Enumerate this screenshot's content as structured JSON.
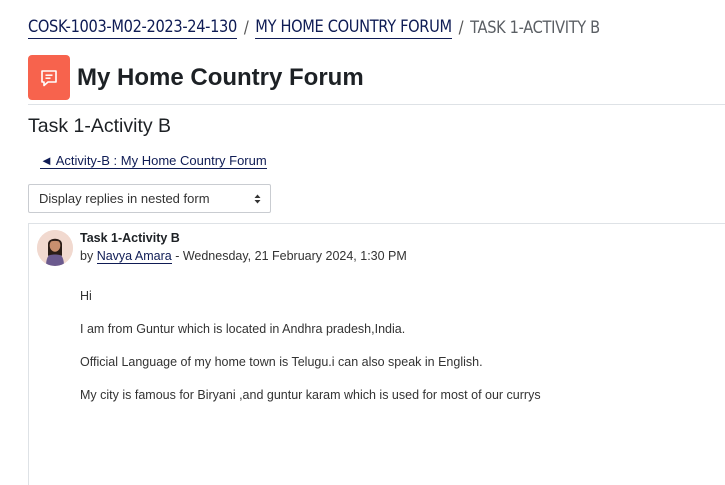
{
  "breadcrumb": {
    "course": "COSK-1003-M02-2023-24-130",
    "separator": "/",
    "forum": "MY HOME COUNTRY FORUM",
    "current": "TASK 1-ACTIVITY B"
  },
  "header": {
    "icon": "forum-chat-icon",
    "title": "My Home Country Forum",
    "accent_color": "#f7634d"
  },
  "discussion": {
    "title": "Task 1-Activity B",
    "back_link": "◄ Activity-B : My Home Country Forum",
    "display_mode": "Display replies in nested form"
  },
  "post": {
    "subject": "Task 1-Activity B",
    "by_prefix": "by",
    "author": "Navya Amara",
    "date": " - Wednesday, 21 February 2024, 1:30 PM",
    "paragraphs": [
      "Hi",
      "I am from Guntur which is located in Andhra pradesh,India.",
      "Official Language of my home town is Telugu.i can also speak in English.",
      "My city is famous for Biryani ,and guntur karam which is used for most of our currys"
    ]
  }
}
